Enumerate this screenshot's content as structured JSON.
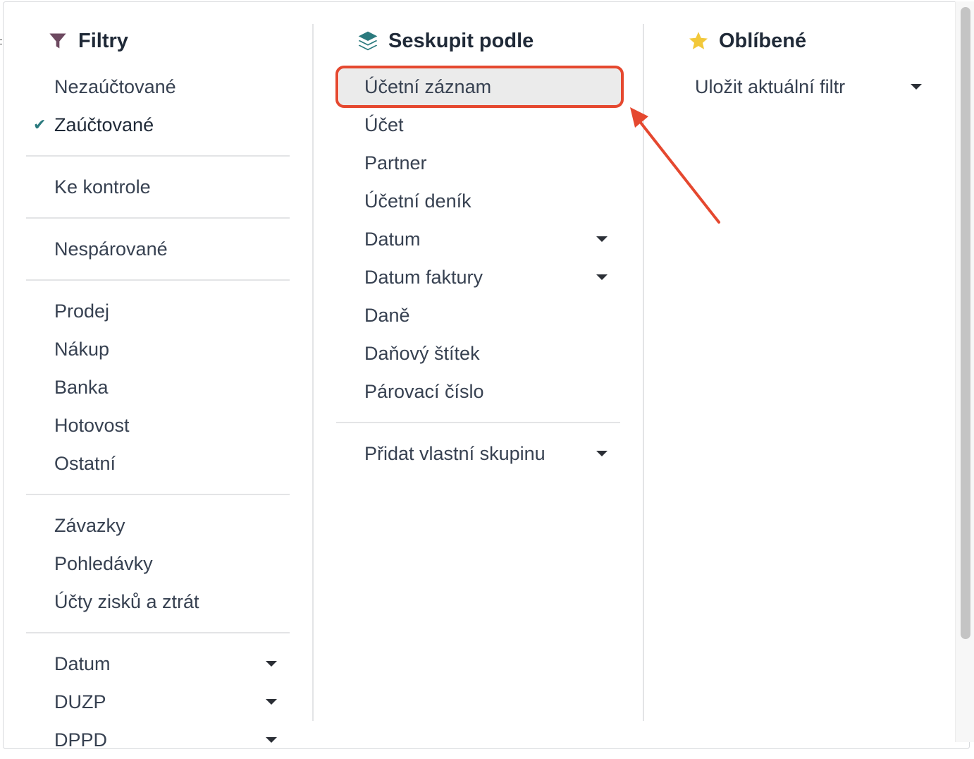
{
  "filters": {
    "title": "Filtry",
    "icon": "filter-icon",
    "items": [
      {
        "label": "Nezaúčtované",
        "selected": false
      },
      {
        "label": "Zaúčtované",
        "selected": true
      },
      {
        "label": "Ke kontrole"
      },
      {
        "label": "Nespárované"
      },
      {
        "label": "Prodej"
      },
      {
        "label": "Nákup"
      },
      {
        "label": "Banka"
      },
      {
        "label": "Hotovost"
      },
      {
        "label": "Ostatní"
      },
      {
        "label": "Závazky"
      },
      {
        "label": "Pohledávky"
      },
      {
        "label": "Účty zisků a ztrát"
      },
      {
        "label": "Datum",
        "has_dropdown": true
      },
      {
        "label": "DUZP",
        "has_dropdown": true
      },
      {
        "label": "DPPD",
        "has_dropdown": true
      }
    ],
    "check_glyph": "✔"
  },
  "group_by": {
    "title": "Seskupit podle",
    "icon": "layers-icon",
    "items": [
      {
        "label": "Účetní záznam",
        "highlighted": true
      },
      {
        "label": "Účet"
      },
      {
        "label": "Partner"
      },
      {
        "label": "Účetní deník"
      },
      {
        "label": "Datum",
        "has_dropdown": true
      },
      {
        "label": "Datum faktury",
        "has_dropdown": true
      },
      {
        "label": "Daně"
      },
      {
        "label": "Daňový štítek"
      },
      {
        "label": "Párovací číslo"
      },
      {
        "label": "Přidat vlastní skupinu",
        "has_dropdown": true
      }
    ]
  },
  "favorites": {
    "title": "Oblíbené",
    "icon": "star-icon",
    "items": [
      {
        "label": "Uložit aktuální filtr",
        "has_dropdown": true
      }
    ]
  },
  "colors": {
    "accent_teal": "#2b7a7e",
    "filter_icon": "#6d4960",
    "star": "#f2c83a",
    "annotation": "#e5482f",
    "highlight_bg": "#ebebeb"
  }
}
